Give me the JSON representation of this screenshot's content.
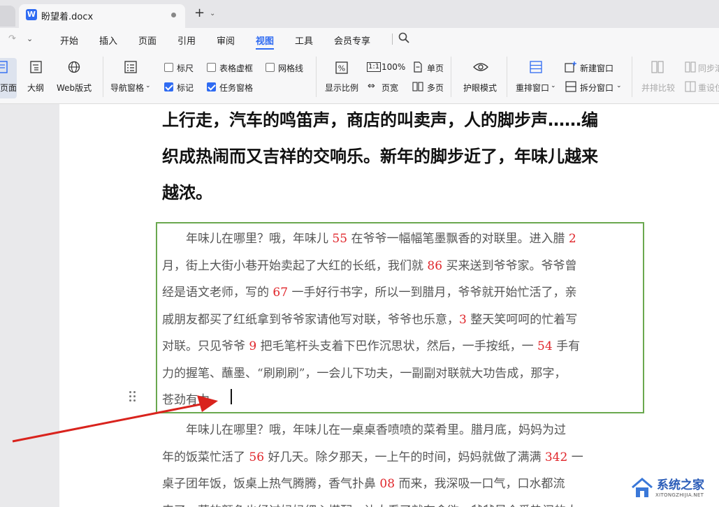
{
  "tab": {
    "filename": "盼望着.docx",
    "new_tab": "+"
  },
  "menu": {
    "items": [
      "开始",
      "插入",
      "页面",
      "引用",
      "审阅",
      "视图",
      "工具",
      "会员专享"
    ],
    "active": "视图"
  },
  "ribbon": {
    "page_view": "页面",
    "outline": "大纲",
    "web_layout": "Web版式",
    "nav_pane": "导航窗格",
    "ruler": {
      "label": "标尺",
      "checked": false
    },
    "mark": {
      "label": "标记",
      "checked": true
    },
    "table_gridlines": {
      "label": "表格虚框",
      "checked": false
    },
    "task_pane": {
      "label": "任务窗格",
      "checked": true
    },
    "gridlines": {
      "label": "网格线",
      "checked": false
    },
    "zoom": "显示比例",
    "zoom_100": "100%",
    "page_width": "页宽",
    "single_page": "单页",
    "multi_page": "多页",
    "eye_protection": "护眼模式",
    "arrange_windows": "重排窗口",
    "new_window": "新建窗口",
    "split_window": "拆分窗口",
    "side_by_side": "并排比较",
    "sync_scroll": "同步滚",
    "reset_position": "重设位"
  },
  "document": {
    "heading_lines": [
      "上行走，汽车的鸣笛声，商店的叫卖声，人的脚步声……编",
      "织成热闹而又吉祥的交响乐。新年的脚步近了，年味儿越来",
      "越浓。"
    ],
    "para1_lines": [
      [
        "　　年味儿在哪里？哦，年味儿 ",
        {
          "n": "55"
        },
        " 在爷爷一幅幅笔墨飘香的对联里。进入腊 ",
        {
          "n": "2"
        }
      ],
      [
        "月，街上大街小巷开始卖起了大红的长纸，我们就 ",
        {
          "n": "86"
        },
        " 买来送到爷爷家。爷爷曾"
      ],
      [
        "经是语文老师，写的 ",
        {
          "n": "67"
        },
        " 一手好行书字，所以一到腊月，爷爷就开始忙活了，亲"
      ],
      [
        "戚朋友都买了红纸拿到爷爷家请他写对联，爷爷也乐意，",
        {
          "n": "3"
        },
        " 整天笑呵呵的忙着写"
      ],
      [
        "对联。只见爷爷 ",
        {
          "n": "9"
        },
        " 把毛笔杆头支着下巴作沉思状，然后，一手按纸，一 ",
        {
          "n": "54"
        },
        " 手有"
      ],
      [
        "力的握笔、蘸墨、“刷刷刷”，一会儿下功夫，一副副对联就大功告成，那字，"
      ],
      [
        "苍劲有力。"
      ]
    ],
    "para2_lines": [
      [
        "　　年味儿在哪里？哦，年味儿在一桌桌香喷喷的菜肴里。腊月底，妈妈为过"
      ],
      [
        "年的饭菜忙活了 ",
        {
          "n": "56"
        },
        " 好几天。除夕那天，一上午的时间，妈妈就做了满满 ",
        {
          "n": "342"
        },
        " 一"
      ],
      [
        "桌子团年饭，饭桌上热气腾腾，香气扑鼻 ",
        {
          "n": "08"
        },
        " 而来，我深吸一口气，口水都流"
      ],
      [
        "来了。菜的颜色也经过妈妈细心搭配，让人看了就有食欲。爷爷是个爱热闹的人"
      ]
    ]
  },
  "watermark": {
    "title": "系统之家",
    "subtitle": "XITONGZHIJIA.NET"
  },
  "colors": {
    "accent": "#2f6bf2",
    "number_red": "#e0262b",
    "frame_green": "#6aa84f",
    "arrow_red": "#d9231d"
  }
}
